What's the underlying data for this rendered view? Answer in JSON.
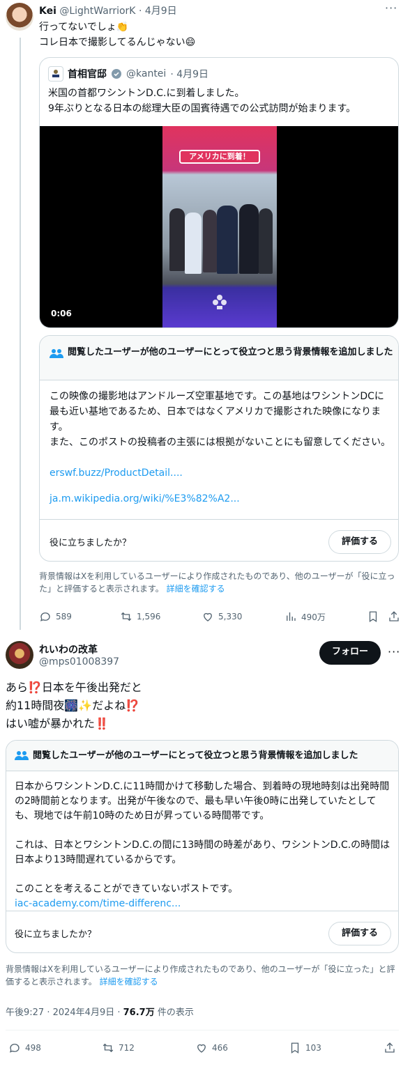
{
  "tweet1": {
    "name": "Kei",
    "handle": "@LightWarriorK",
    "date": "· 4月9日",
    "line1": "行ってないでしょ👏",
    "line2": "コレ日本で撮影してるんじゃない😄"
  },
  "quote": {
    "name": "首相官邸",
    "handle": "@kantei",
    "date": "· 4月9日",
    "line1": "米国の首都ワシントンD.C.に到着しました。",
    "line2": "9年ぶりとなる日本の総理大臣の国賓待遇での公式訪問が始まります。",
    "video_banner": "アメリカに到着！",
    "video_time": "0:06"
  },
  "note1": {
    "header": "閲覧したユーザーが他のユーザーにとって役立つと思う背景情報を追加しました",
    "p1": "この映像の撮影地はアンドルーズ空軍基地です。この基地はワシントンDCに最も近い基地であるため、日本ではなくアメリカで撮影された映像になります。",
    "p2": "また、このポストの投稿者の主張には根拠がないことにも留意してください。",
    "link1": "erswf.buzz/ProductDetail....",
    "link2": "ja.m.wikipedia.org/wiki/%E3%82%A2...",
    "question": "役に立ちましたか？",
    "rate": "評価する",
    "disclaimer": "背景情報はXを利用しているユーザーにより作成されたものであり、他のユーザーが「役に立った」と評価すると表示されます。",
    "details": "詳細を確認する"
  },
  "actions1": {
    "replies": "589",
    "retweets": "1,596",
    "likes": "5,330",
    "views": "490万"
  },
  "tweet2": {
    "name": "れいわの改革",
    "handle": "@mps01008397",
    "follow": "フォロー",
    "line1": "あら⁉️日本を午後出発だと",
    "line2": "約11時間夜🎆✨だよね⁉️",
    "line3": "はい嘘が暴かれた‼️"
  },
  "note2": {
    "header": "閲覧したユーザーが他のユーザーにとって役立つと思う背景情報を追加しました",
    "p1": "日本からワシントンD.C.に11時間かけて移動した場合、到着時の現地時刻は出発時間の2時間前となります。出発が午後なので、最も早い午後0時に出発していたとしても、現地では午前10時のため日が昇っている時間帯です。",
    "p2": "これは、日本とワシントンD.C.の間に13時間の時差があり、ワシントンD.C.の時間は日本より13時間遅れているからです。",
    "p3": "このことを考えることができていないポストです。",
    "link1": "iac-academy.com/time-differenc...",
    "question": "役に立ちましたか？",
    "rate": "評価する",
    "disclaimer": "背景情報はXを利用しているユーザーにより作成されたものであり、他のユーザーが「役に立った」と評価すると表示されます。",
    "details": "詳細を確認する"
  },
  "meta2": {
    "time": "午後9:27 · 2024年4月9日 · ",
    "views": "76.7万",
    "views_suffix": " 件の表示"
  },
  "actions2": {
    "replies": "498",
    "retweets": "712",
    "likes": "466",
    "bookmarks": "103"
  },
  "colors": {
    "link": "#1d9bf0",
    "verified": "#829aab",
    "note_icon": "#1d9bf0"
  }
}
